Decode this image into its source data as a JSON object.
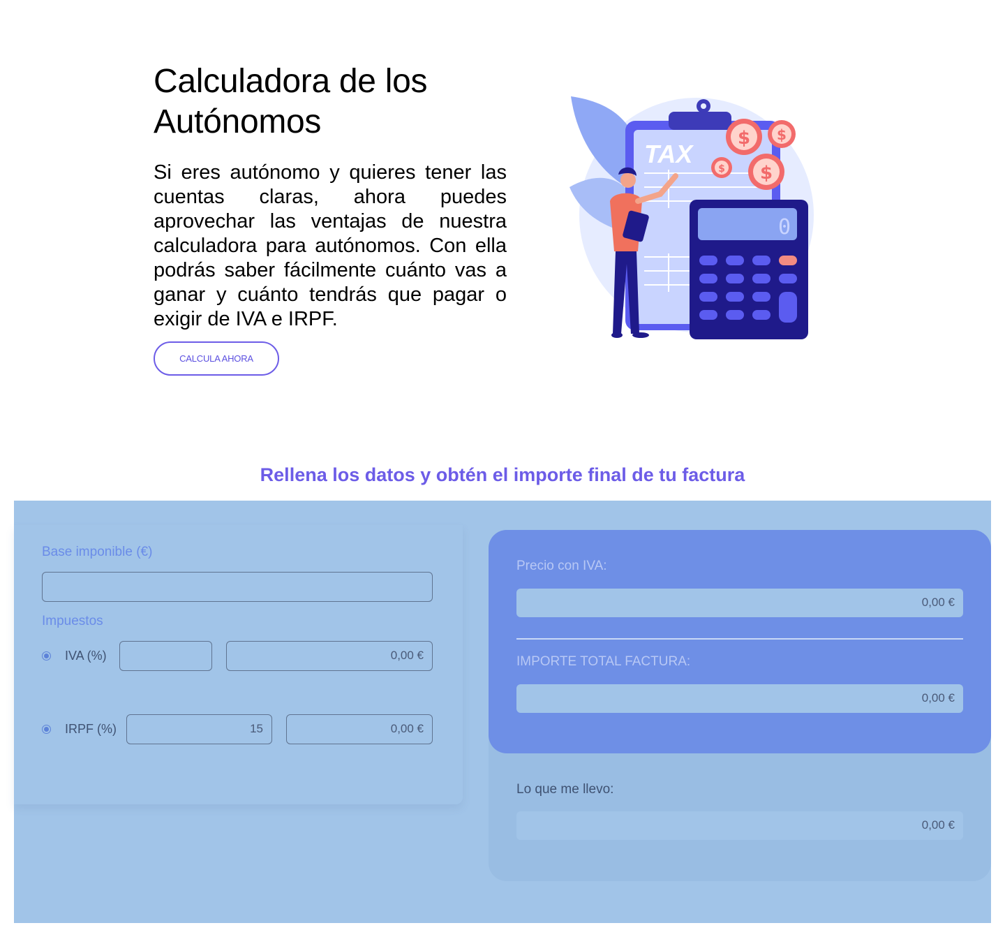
{
  "hero": {
    "title": "Calculadora de los Autónomos",
    "description": "Si eres autónomo y quieres tener las cuentas claras, ahora puedes aprovechar las ventajas de nuestra calculadora para autónomos. Con ella podrás saber fácilmente cuánto vas a ganar y cuánto tendrás que pagar o exigir de IVA e IRPF.",
    "cta_label": "CALCULA AHORA",
    "illustration": {
      "icon": "tax-calculator-illustration",
      "clipboard_text": "TAX",
      "display_value": "0"
    }
  },
  "section": {
    "heading": "Rellena los datos y obtén el importe final de tu factura"
  },
  "form": {
    "base_label": "Base imponible (€)",
    "base_value": "",
    "taxes_label": "Impuestos",
    "iva": {
      "label": "IVA (%)",
      "percent_value": "",
      "amount": "0,00 €"
    },
    "irpf": {
      "label": "IRPF (%)",
      "percent_value": "15",
      "amount": "0,00 €"
    }
  },
  "results": {
    "price_with_iva_label": "Precio con IVA:",
    "price_with_iva_value": "0,00 €",
    "total_label": "IMPORTE TOTAL FACTURA:",
    "total_value": "0,00 €",
    "take_home_label": "Lo que me llevo:",
    "take_home_value": "0,00 €"
  },
  "colors": {
    "accent": "#6c5ce7",
    "panel_bg": "#a1c4e8",
    "result_card": "#6e8fe6",
    "coin": "#f26b6b"
  }
}
